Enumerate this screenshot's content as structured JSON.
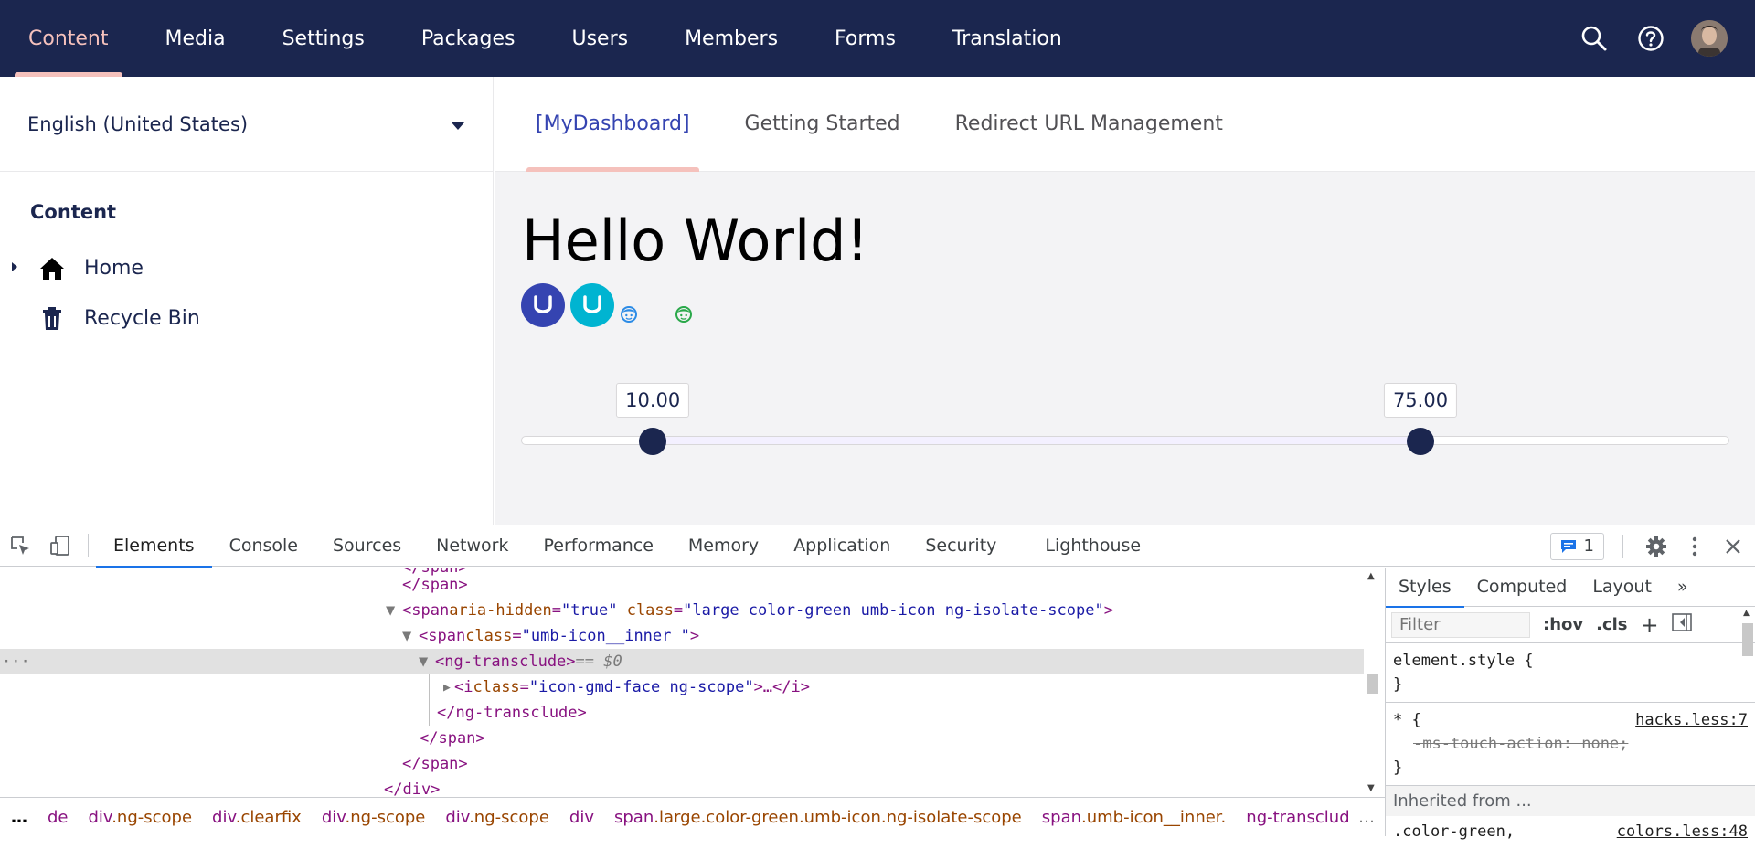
{
  "topnav": {
    "items": [
      {
        "label": "Content"
      },
      {
        "label": "Media"
      },
      {
        "label": "Settings"
      },
      {
        "label": "Packages"
      },
      {
        "label": "Users"
      },
      {
        "label": "Members"
      },
      {
        "label": "Forms"
      },
      {
        "label": "Translation"
      }
    ],
    "active_index": 0,
    "accent_color": "#f5c1bc",
    "bg_color": "#1b264f",
    "right_icons": [
      "search-icon",
      "help-icon",
      "avatar"
    ]
  },
  "sidebar": {
    "language": "English (United States)",
    "tree_title": "Content",
    "tree_items": [
      {
        "label": "Home",
        "icon": "home-icon",
        "expandable": true
      },
      {
        "label": "Recycle Bin",
        "icon": "trash-icon",
        "expandable": false
      }
    ]
  },
  "main": {
    "tabs": [
      {
        "label": "[MyDashboard]"
      },
      {
        "label": "Getting Started"
      },
      {
        "label": "Redirect URL Management"
      }
    ],
    "active_tab": 0,
    "headline": "Hello World!",
    "icons": [
      "umbraco-logo-blue",
      "umbraco-logo-cyan",
      "face-icon-blue",
      "face-icon-green"
    ],
    "slider": {
      "min_value": "10.00",
      "max_value": "75.00",
      "range_min": 0,
      "range_max": 100,
      "low": 10,
      "high": 75
    }
  },
  "devtools": {
    "tabs": [
      {
        "label": "Elements"
      },
      {
        "label": "Console"
      },
      {
        "label": "Sources"
      },
      {
        "label": "Network"
      },
      {
        "label": "Performance"
      },
      {
        "label": "Memory"
      },
      {
        "label": "Application"
      },
      {
        "label": "Security"
      },
      {
        "label": "Lighthouse"
      }
    ],
    "active_tab": 0,
    "issues_count": "1",
    "dom_lines": {
      "l1": "</span>",
      "l2_tag": "<span ",
      "l2_a1": "aria-hidden",
      "l2_v1": "\"true\"",
      "l2_a2": "class",
      "l2_v2": "\"large color-green umb-icon ng-isolate-scope\"",
      "l2_end": ">",
      "l3_tag": "<span ",
      "l3_a1": "class",
      "l3_v1": "\"umb-icon__inner \"",
      "l3_end": ">",
      "l4_tag": "<ng-transclude>",
      "l4_eq": " == $0",
      "l5_tag": "<i ",
      "l5_a1": "class",
      "l5_v1": "\"icon-gmd-face ng-scope\"",
      "l5_end": ">…</i>",
      "l6": "</ng-transclude>",
      "l7": "</span>",
      "l8": "</span>",
      "l9": "</div>"
    },
    "styles": {
      "tabs": [
        {
          "label": "Styles"
        },
        {
          "label": "Computed"
        },
        {
          "label": "Layout"
        }
      ],
      "filter_placeholder": "Filter",
      "hov": ":hov",
      "cls": ".cls",
      "rule1_selector": "element.style {",
      "rule1_close": "}",
      "rule2_selector": "* {",
      "rule2_source": "hacks.less:7",
      "rule2_prop": "-ms-touch-action: none;",
      "rule2_close": "}",
      "inherited": "Inherited from ...",
      "rule3_selector": ".color-green,",
      "rule3_source": "colors.less:48"
    },
    "breadcrumbs": [
      {
        "tag": "",
        "cls": "de"
      },
      {
        "tag": "div",
        "cls": ".ng-scope"
      },
      {
        "tag": "div",
        "cls": ".clearfix"
      },
      {
        "tag": "div",
        "cls": ".ng-scope"
      },
      {
        "tag": "div",
        "cls": ".ng-scope"
      },
      {
        "tag": "div",
        "cls": ""
      },
      {
        "tag": "span",
        "cls": ".large.color-green.umb-icon.ng-isolate-scope"
      },
      {
        "tag": "span",
        "cls": ".umb-icon__inner."
      },
      {
        "tag": "ng-transclude",
        "cls": ""
      }
    ],
    "breadcrumb_ellipsis": "…"
  }
}
